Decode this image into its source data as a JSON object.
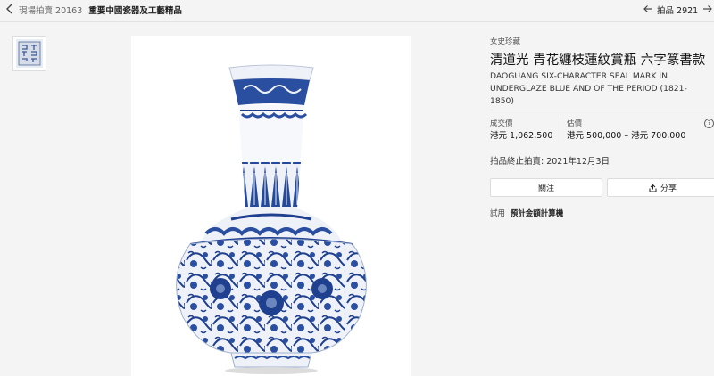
{
  "breadcrumb": {
    "sale_type": "現場拍賣",
    "sale_number": "20163",
    "sale_title": "重要中國瓷器及工藝精品"
  },
  "lot_nav": {
    "lot_label": "拍品 2921"
  },
  "thumbnail": {
    "alt": "seal mark"
  },
  "lot": {
    "provenance": "女史珍藏",
    "title_cn": "清道光 青花纏枝蓮紋賞瓶 六字篆書款",
    "title_en": "DAOGUANG SIX-CHARACTER SEAL MARK IN UNDERGLAZE BLUE AND OF THE PERIOD (1821-1850)"
  },
  "pricing": {
    "realised_label": "成交價",
    "realised_value": "港元 1,062,500",
    "estimate_label": "估價",
    "estimate_value": "港元 500,000 – 港元 700,000",
    "help_glyph": "?"
  },
  "sale_status": "拍品終止拍賣: 2021年12月3日",
  "actions": {
    "follow_label": "關注",
    "share_label": "分享"
  },
  "calculator": {
    "prefix": "試用",
    "link_label": "預計金額計算機"
  },
  "colors": {
    "page_bg": "#f4f4f4",
    "cobalt_blue": "#1f3f8f",
    "porcelain_white": "#ffffff"
  }
}
